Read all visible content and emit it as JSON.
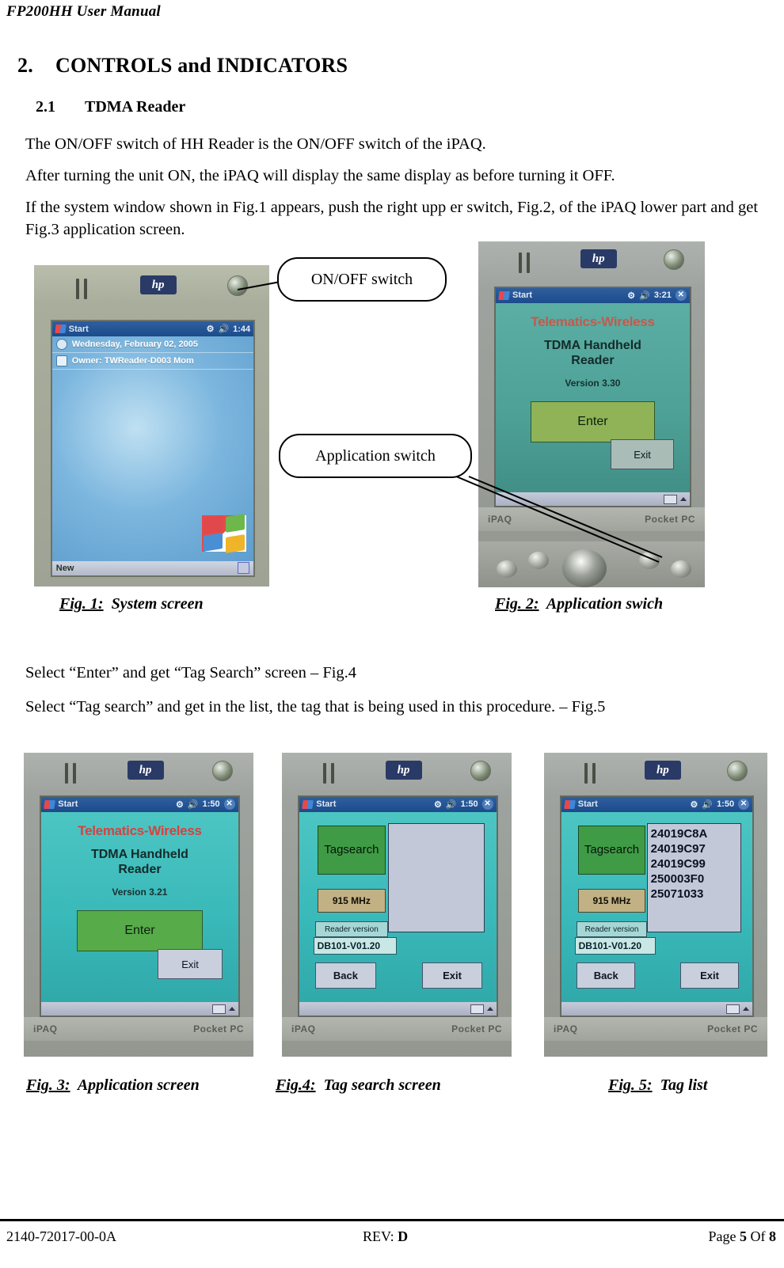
{
  "header": {
    "title": "FP200HH User Manual"
  },
  "headings": {
    "section_number": "2.",
    "section_title": "CONTROLS and INDICATORS",
    "sub_number": "2.1",
    "sub_title": "TDMA Reader"
  },
  "paragraphs": {
    "p1": "The ON/OFF switch of HH Reader is the ON/OFF switch of the iPAQ.",
    "p2": "After turning the unit ON, the iPAQ will display the same display as before turning it OFF.",
    "p3": "If the system window shown in Fig.1 appears, push the right upp er switch, Fig.2, of the iPAQ lower part and get Fig.3 application screen.",
    "p4": "Select “Enter” and get “Tag Search” screen – Fig.4",
    "p5": "Select “Tag search” and get in the list, the tag that is being used in this procedure. – Fig.5"
  },
  "callouts": {
    "on_off": "ON/OFF switch",
    "application": "Application switch"
  },
  "captions": {
    "fig1_label": "Fig. 1:",
    "fig1_text": "System screen",
    "fig2_label": "Fig. 2:",
    "fig2_text": "Application swich",
    "fig3_label": "Fig. 3:",
    "fig3_text": "Application screen",
    "fig4_label": "Fig.4:",
    "fig4_text": "Tag search screen",
    "fig5_label": "Fig. 5:",
    "fig5_text": "Tag list"
  },
  "fig1": {
    "brand": "hp",
    "taskbar": {
      "start": "Start",
      "time": "1:44"
    },
    "today_date": "Wednesday, February 02, 2005",
    "today_owner": "Owner: TWReader-D003 Mom",
    "softkey_new": "New"
  },
  "fig2": {
    "brand": "hp",
    "taskbar": {
      "start": "Start",
      "time": "3:21"
    },
    "app_title": "Telematics-Wireless",
    "app_sub_line1": "TDMA Handheld",
    "app_sub_line2": "Reader",
    "version": "Version 3.30",
    "btn_enter": "Enter",
    "btn_exit": "Exit",
    "device_left": "iPAQ",
    "device_right": "Pocket PC"
  },
  "fig3": {
    "brand": "hp",
    "taskbar": {
      "start": "Start",
      "time": "1:50"
    },
    "app_title": "Telematics-Wireless",
    "app_sub_line1": "TDMA Handheld",
    "app_sub_line2": "Reader",
    "version": "Version 3.21",
    "btn_enter": "Enter",
    "btn_exit": "Exit",
    "device_left": "iPAQ",
    "device_right": "Pocket PC"
  },
  "fig4": {
    "brand": "hp",
    "taskbar": {
      "start": "Start",
      "time": "1:50"
    },
    "btn_tag_line1": "Tag",
    "btn_tag_line2": "search",
    "btn_freq": "915 MHz",
    "label_reader_version": "Reader version",
    "value_reader_version": "DB101-V01.20",
    "tag_list": [],
    "btn_back": "Back",
    "btn_exit": "Exit",
    "device_left": "iPAQ",
    "device_right": "Pocket PC"
  },
  "fig5": {
    "brand": "hp",
    "taskbar": {
      "start": "Start",
      "time": "1:50"
    },
    "btn_tag_line1": "Tag",
    "btn_tag_line2": "search",
    "btn_freq": "915 MHz",
    "label_reader_version": "Reader version",
    "value_reader_version": "DB101-V01.20",
    "tag_list": [
      "24019C8A",
      "24019C97",
      "24019C99",
      "250003F0",
      "25071033"
    ],
    "btn_back": "Back",
    "btn_exit": "Exit",
    "device_left": "iPAQ",
    "device_right": "Pocket PC"
  },
  "footer": {
    "doc_number": "2140-72017-00-0A",
    "rev_label": "REV: ",
    "rev_value": "D",
    "page_prefix": "Page ",
    "page_number": "5",
    "page_middle": " Of ",
    "page_total": "8"
  }
}
